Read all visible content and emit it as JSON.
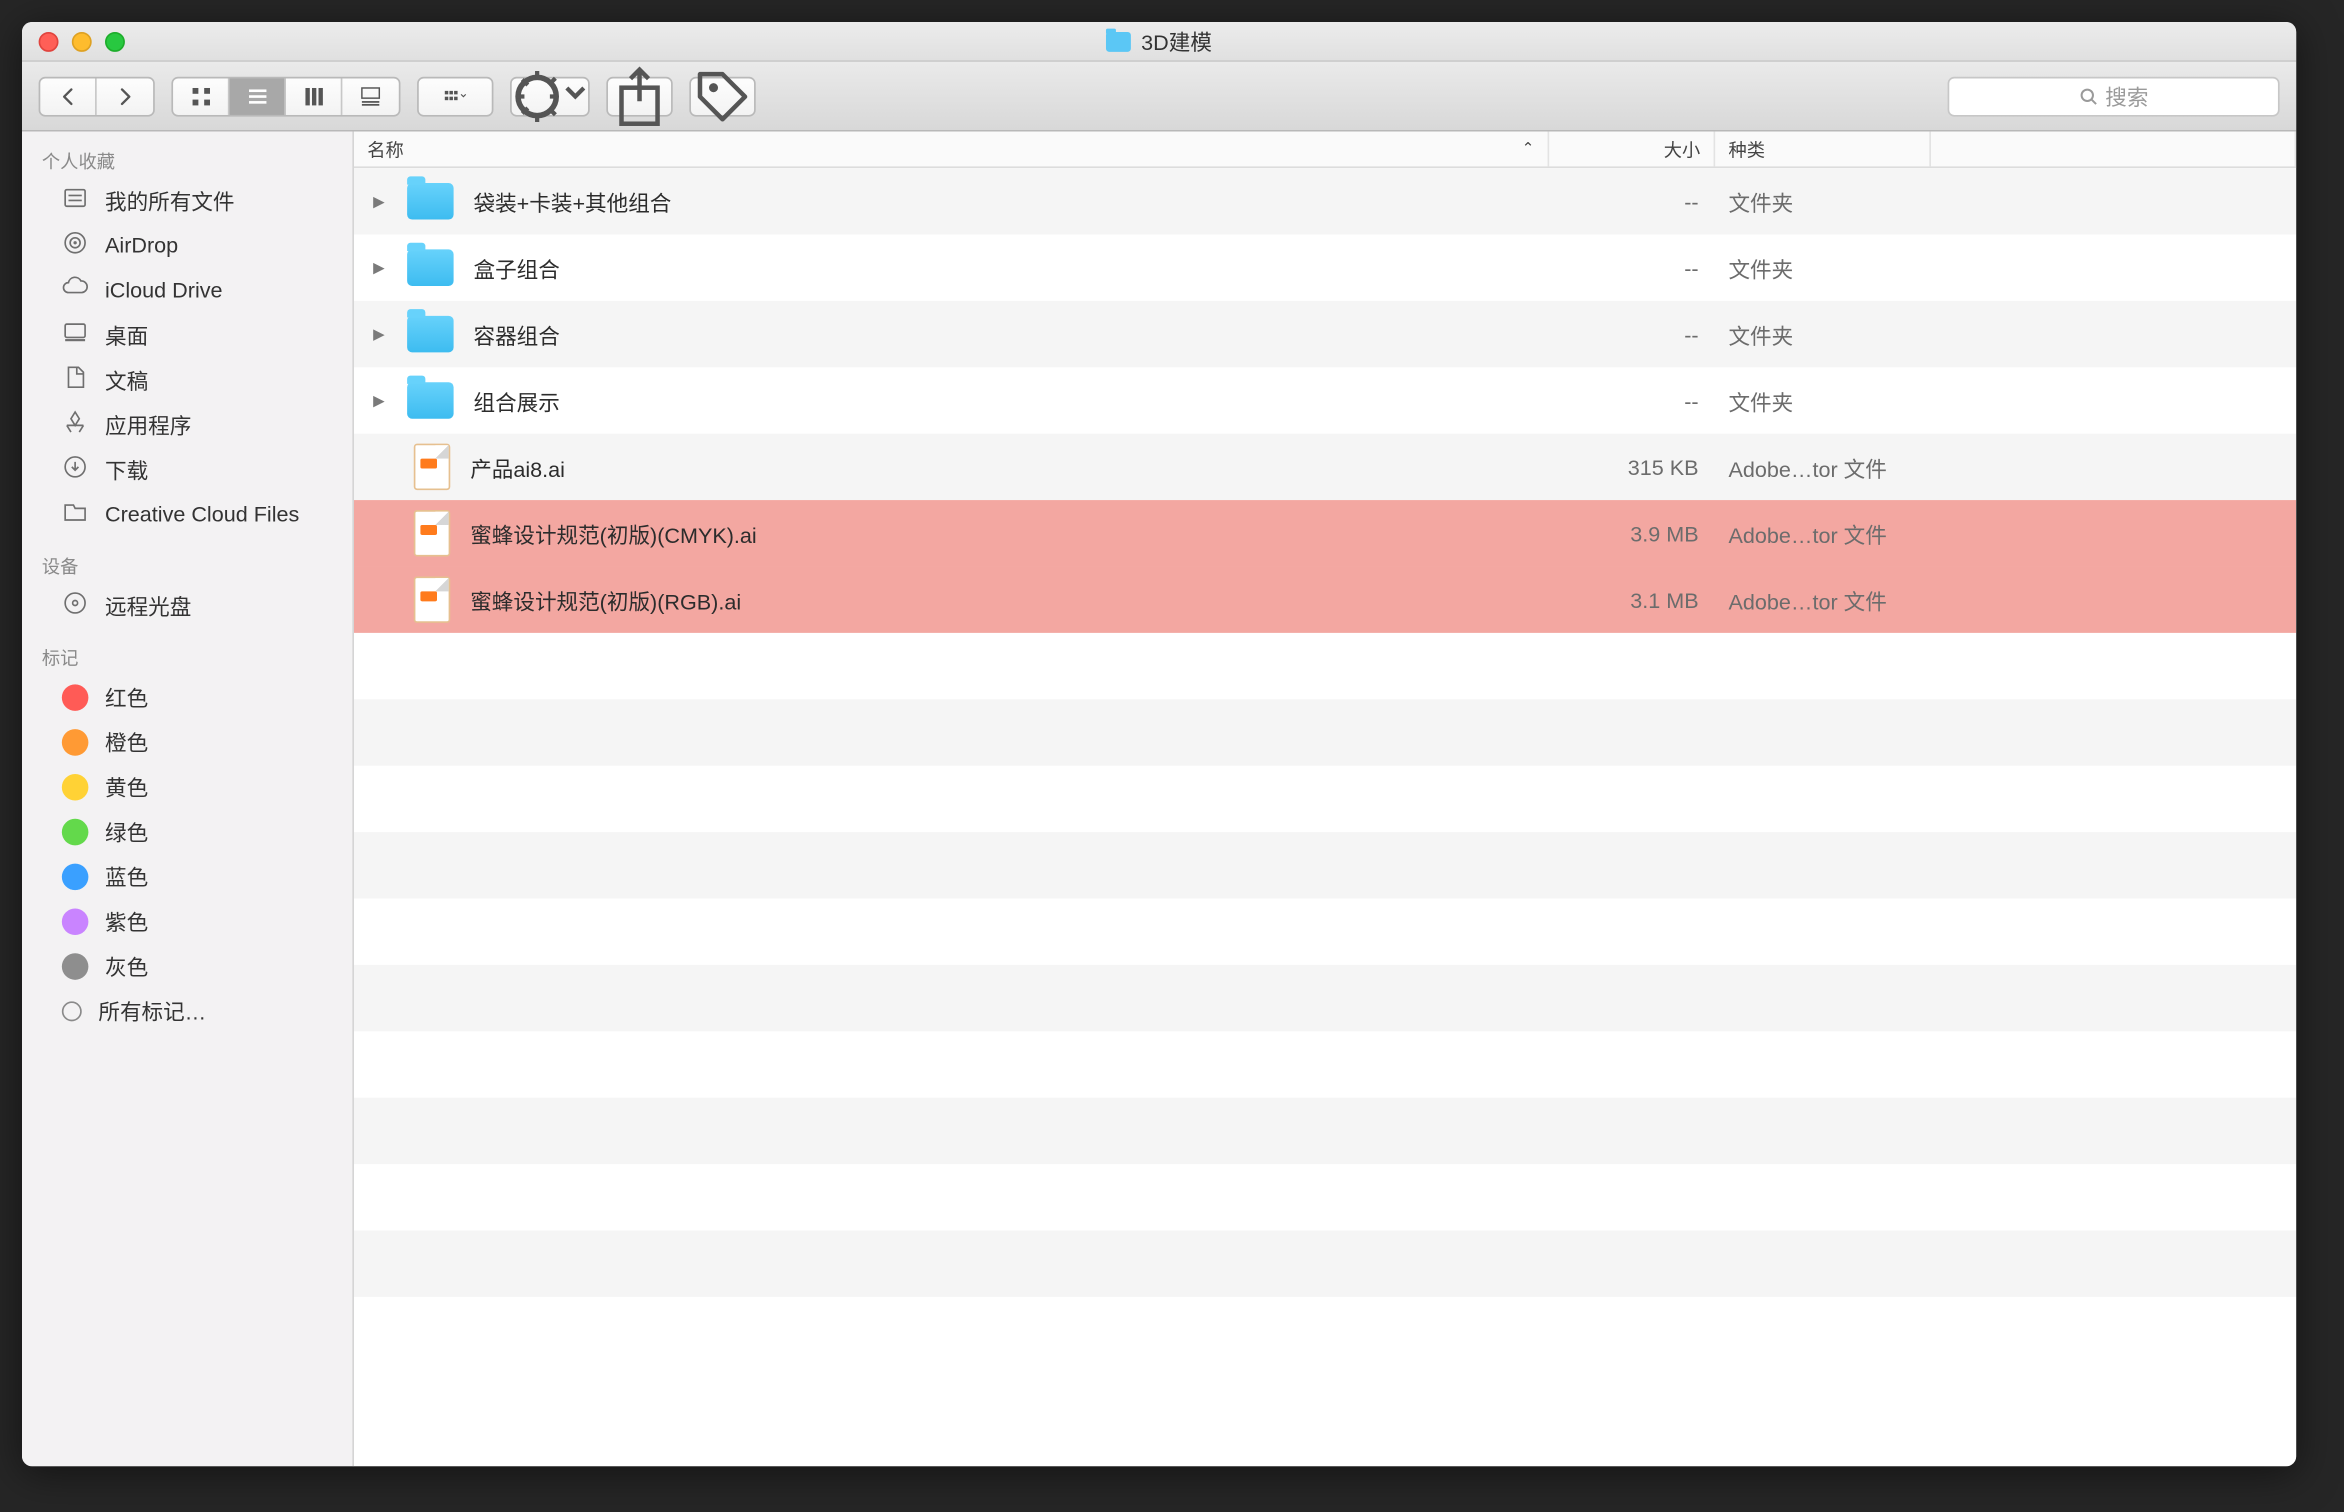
{
  "window": {
    "title": "3D建模"
  },
  "toolbar": {
    "search_placeholder": "搜索"
  },
  "sidebar": {
    "section_favorites": "个人收藏",
    "section_devices": "设备",
    "section_tags": "标记",
    "favorites": [
      {
        "label": "我的所有文件",
        "icon": "all-files"
      },
      {
        "label": "AirDrop",
        "icon": "airdrop"
      },
      {
        "label": "iCloud Drive",
        "icon": "icloud"
      },
      {
        "label": "桌面",
        "icon": "desktop"
      },
      {
        "label": "文稿",
        "icon": "documents"
      },
      {
        "label": "应用程序",
        "icon": "apps"
      },
      {
        "label": "下载",
        "icon": "downloads"
      },
      {
        "label": "Creative Cloud Files",
        "icon": "folder"
      }
    ],
    "devices": [
      {
        "label": "远程光盘",
        "icon": "disc"
      }
    ],
    "tags": [
      {
        "label": "红色",
        "color": "#ff5b56"
      },
      {
        "label": "橙色",
        "color": "#ff9a34"
      },
      {
        "label": "黄色",
        "color": "#ffd235"
      },
      {
        "label": "绿色",
        "color": "#63d94b"
      },
      {
        "label": "蓝色",
        "color": "#3aa0ff"
      },
      {
        "label": "紫色",
        "color": "#c984ff"
      },
      {
        "label": "灰色",
        "color": "#8e8e8e"
      }
    ],
    "all_tags_label": "所有标记…"
  },
  "columns": {
    "name": "名称",
    "size": "大小",
    "kind": "种类"
  },
  "files": [
    {
      "type": "folder",
      "name": "袋装+卡装+其他组合",
      "size": "--",
      "kind": "文件夹",
      "highlight": false
    },
    {
      "type": "folder",
      "name": "盒子组合",
      "size": "--",
      "kind": "文件夹",
      "highlight": false
    },
    {
      "type": "folder",
      "name": "容器组合",
      "size": "--",
      "kind": "文件夹",
      "highlight": false
    },
    {
      "type": "folder",
      "name": "组合展示",
      "size": "--",
      "kind": "文件夹",
      "highlight": false
    },
    {
      "type": "file",
      "name": "产品ai8.ai",
      "size": "315 KB",
      "kind": "Adobe…tor 文件",
      "highlight": false
    },
    {
      "type": "file",
      "name": "蜜蜂设计规范(初版)(CMYK).ai",
      "size": "3.9 MB",
      "kind": "Adobe…tor 文件",
      "highlight": true
    },
    {
      "type": "file",
      "name": "蜜蜂设计规范(初版)(RGB).ai",
      "size": "3.1 MB",
      "kind": "Adobe…tor 文件",
      "highlight": true
    }
  ]
}
